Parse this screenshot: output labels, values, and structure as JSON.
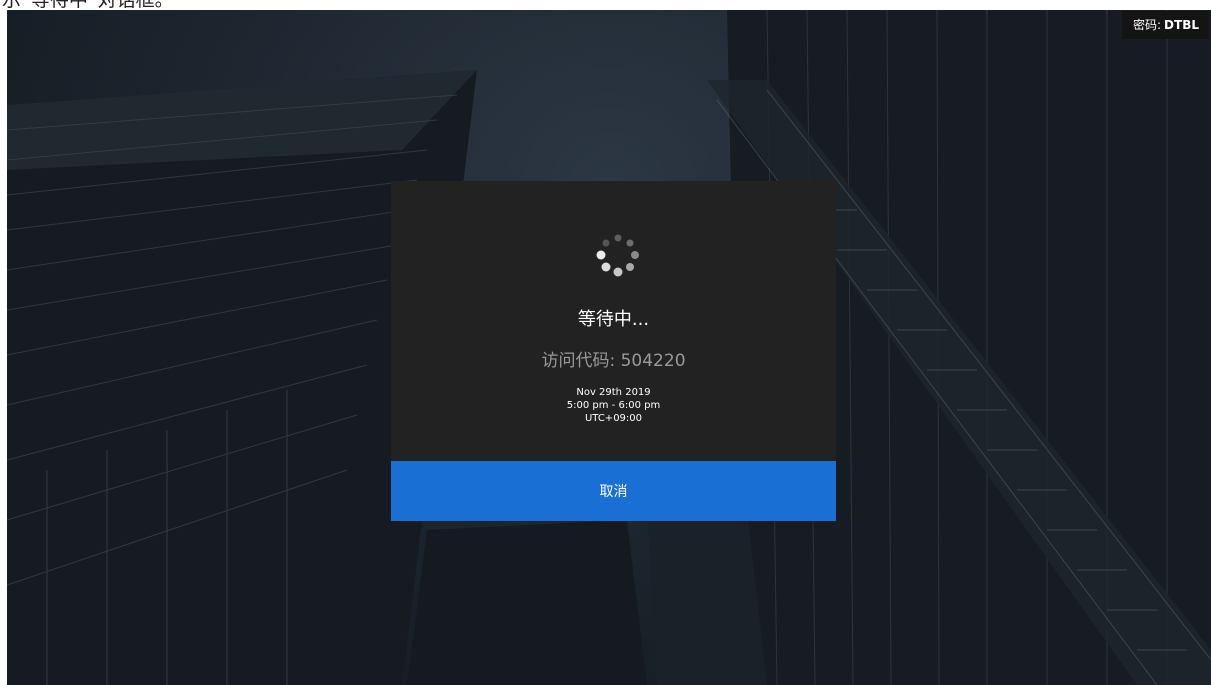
{
  "caption": {
    "text": "示“等待中”对话框。"
  },
  "badge": {
    "label": "密码:",
    "value": "DTBL"
  },
  "dialog": {
    "title": "等待中...",
    "access_code_label": "访问代码:",
    "access_code": "504220",
    "date": "Nov 29th 2019",
    "time_range": "5:00 pm - 6:00 pm",
    "timezone": "UTC+09:00",
    "cancel_label": "取消",
    "spinner_icon": "loading-spinner-icon"
  },
  "colors": {
    "accent": "#1a6fd4",
    "dialog_bg": "#222222",
    "code_text": "#9a9a9a"
  }
}
